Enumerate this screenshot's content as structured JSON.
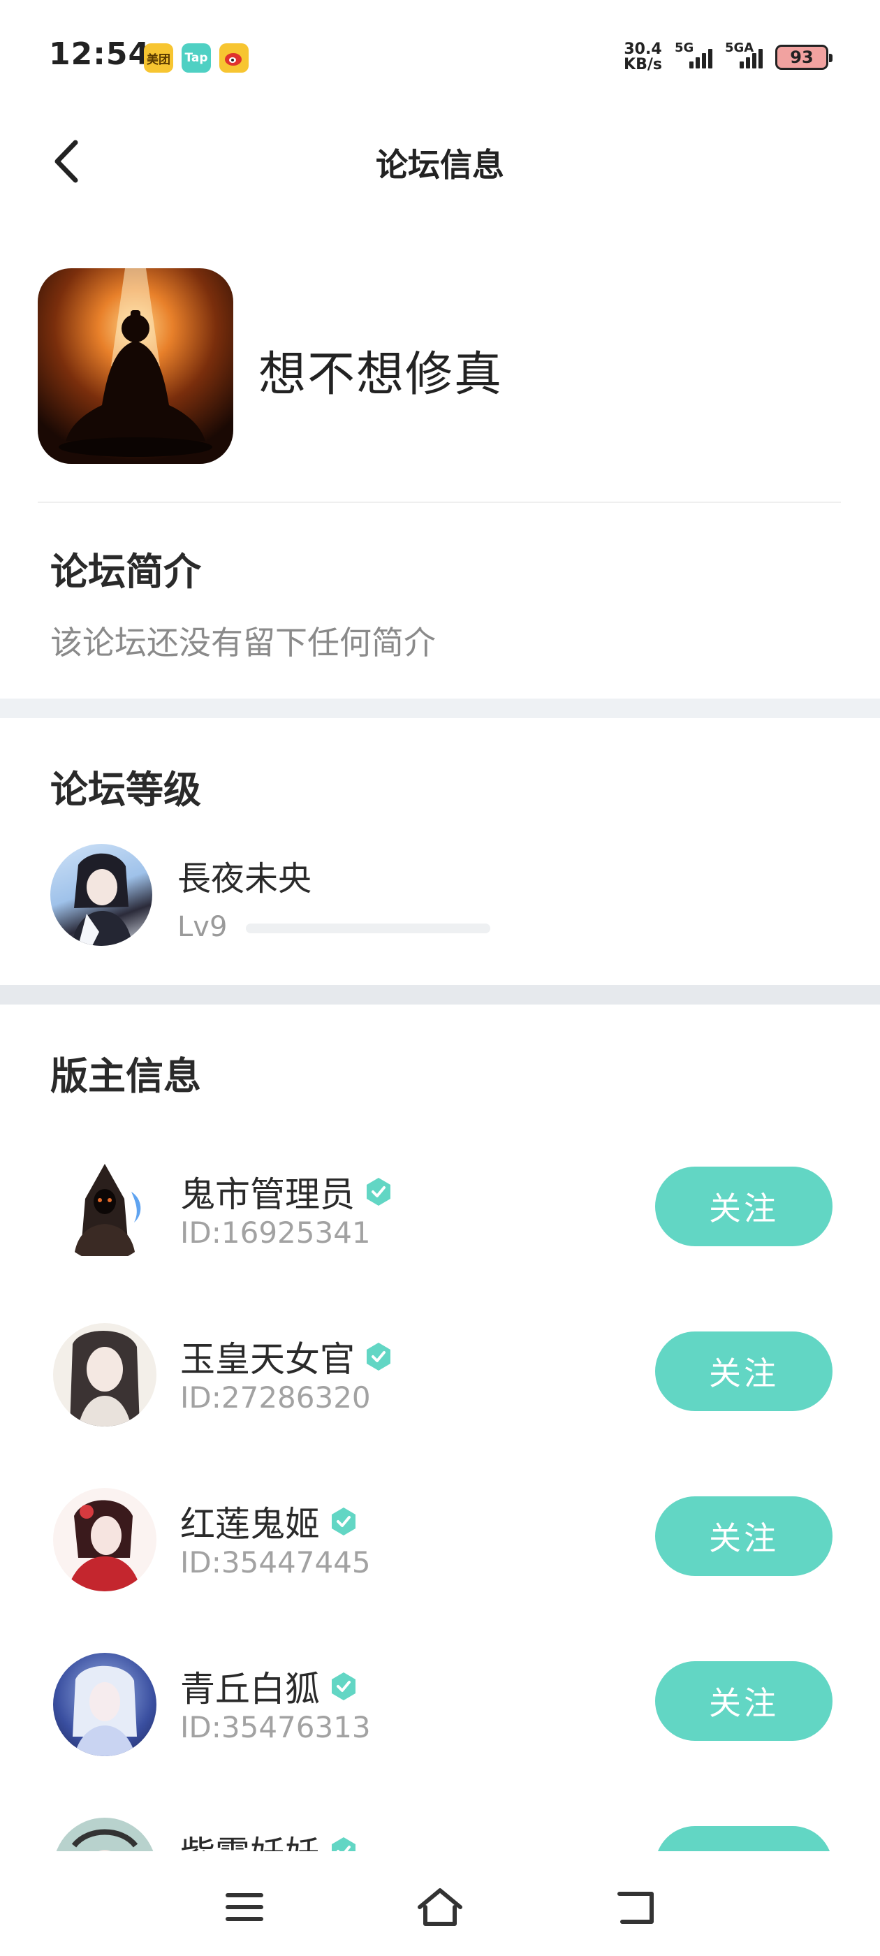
{
  "status_bar": {
    "time": "12:54",
    "apps": [
      "美团",
      "Tap",
      "微博"
    ],
    "net_speed_value": "30.4",
    "net_speed_unit": "KB/s",
    "signal_1_label": "5G",
    "signal_2_label": "5GA",
    "battery": "93"
  },
  "header": {
    "title": "论坛信息"
  },
  "forum": {
    "name": "想不想修真"
  },
  "intro": {
    "title": "论坛简介",
    "text": "该论坛还没有留下任何简介"
  },
  "level": {
    "title": "论坛等级",
    "user_name": "長夜未央",
    "lv": "Lv9",
    "progress": 0.0
  },
  "moderators": {
    "title": "版主信息",
    "follow_label": "关注",
    "items": [
      {
        "name": "鬼市管理员",
        "id": "ID:16925341"
      },
      {
        "name": "玉皇天女官",
        "id": "ID:27286320"
      },
      {
        "name": "红莲鬼姬",
        "id": "ID:35447445"
      },
      {
        "name": "青丘白狐",
        "id": "ID:35476313"
      },
      {
        "name": "紫霞妖妖",
        "id": ""
      }
    ]
  },
  "colors": {
    "accent": "#62d6c4",
    "divider": "#eef1f4"
  }
}
